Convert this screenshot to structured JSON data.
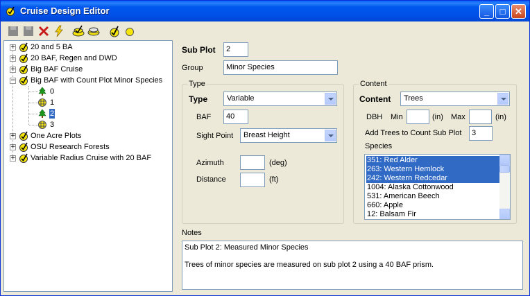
{
  "window": {
    "title": "Cruise Design Editor"
  },
  "title_buttons": {
    "minimize": "_",
    "maximize": "□",
    "close": "✕"
  },
  "toolbar": {
    "items": [
      {
        "name": "save-icon",
        "interactable": true
      },
      {
        "name": "save-disabled-icon",
        "interactable": true
      },
      {
        "name": "delete-icon",
        "interactable": true
      },
      {
        "name": "lightning-icon",
        "interactable": true
      },
      {
        "name": "add-cruise-icon",
        "interactable": true
      },
      {
        "name": "add-plot-icon",
        "interactable": true
      },
      {
        "name": "add-subplot-icon",
        "interactable": true
      },
      {
        "name": "circle-icon",
        "interactable": true
      }
    ]
  },
  "tree": {
    "items": [
      {
        "label": "20 and 5 BA",
        "expander": "+"
      },
      {
        "label": "20 BAF, Regen and DWD",
        "expander": "+"
      },
      {
        "label": "Big BAF Cruise",
        "expander": "+"
      },
      {
        "label": "Big BAF with Count Plot Minor Species",
        "expander": "−"
      },
      {
        "label": "0"
      },
      {
        "label": "1"
      },
      {
        "label": "2"
      },
      {
        "label": "3"
      },
      {
        "label": "One Acre Plots",
        "expander": "+"
      },
      {
        "label": "OSU Research Forests",
        "expander": "+"
      },
      {
        "label": "Variable Radius Cruise with 20 BAF",
        "expander": "+"
      }
    ]
  },
  "form": {
    "subplot_label": "Sub Plot",
    "subplot_value": "2",
    "group_label": "Group",
    "group_value": "Minor Species",
    "type_group": {
      "legend": "Type",
      "type_label": "Type",
      "type_value": "Variable",
      "baf_label": "BAF",
      "baf_value": "40",
      "sight_label": "Sight Point",
      "sight_value": "Breast Height",
      "azimuth_label": "Azimuth",
      "azimuth_value": "",
      "azimuth_unit": "(deg)",
      "distance_label": "Distance",
      "distance_value": "",
      "distance_unit": "(ft)"
    },
    "content_group": {
      "legend": "Content",
      "content_label": "Content",
      "content_value": "Trees",
      "dbh_label": "DBH",
      "min_label": "Min",
      "min_value": "",
      "min_unit": "(in)",
      "max_label": "Max",
      "max_value": "",
      "max_unit": "(in)",
      "add_trees_label": "Add Trees to Count Sub Plot",
      "add_trees_value": "3",
      "species_label": "Species",
      "species": [
        {
          "label": "351: Red Alder",
          "selected": true
        },
        {
          "label": "263: Western Hemlock",
          "selected": true
        },
        {
          "label": "242: Western Redcedar",
          "selected": true
        },
        {
          "label": "1004: Alaska Cottonwood",
          "selected": false
        },
        {
          "label": "531: American Beech",
          "selected": false
        },
        {
          "label": "660: Apple",
          "selected": false
        },
        {
          "label": "12: Balsam Fir",
          "selected": false
        }
      ]
    },
    "notes_label": "Notes",
    "notes_line1": "Sub Plot 2: Measured Minor Species",
    "notes_line2": "Trees of minor species are measured on sub plot 2 using a 40 BAF prism."
  }
}
